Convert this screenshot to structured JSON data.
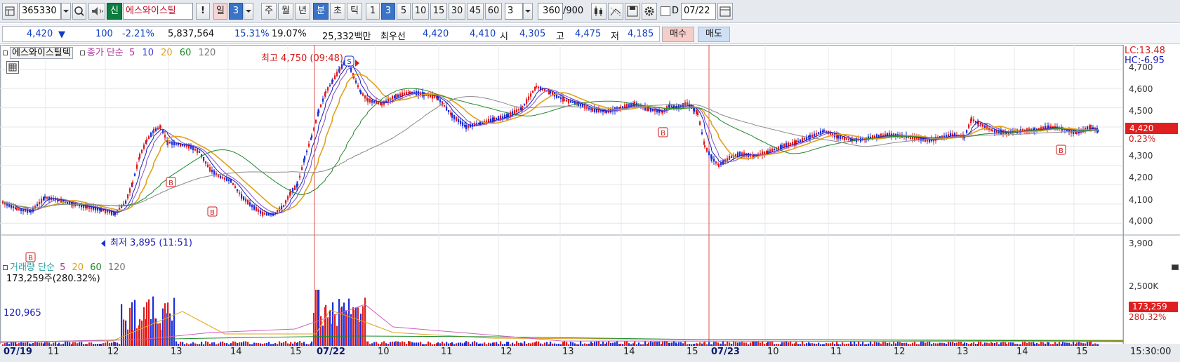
{
  "toolbar": {
    "code": "365330",
    "new_label": "신",
    "stock_name": "에스와이스틸",
    "alert_label": "!",
    "period_day": "일",
    "period_day_num": "3",
    "period_week": "주",
    "period_month": "월",
    "period_year": "년",
    "period_min": "분",
    "period_sec": "초",
    "period_tick": "틱",
    "minute_options": [
      "1",
      "3",
      "5",
      "10",
      "15",
      "30",
      "45",
      "60"
    ],
    "selected_minute": "3",
    "interval_value": "3",
    "count_value": "360",
    "count_max": "/900",
    "d_label": "D",
    "date_value": "07/22",
    "colors": {
      "selected": "#3b73c6",
      "new_badge": "#0c7d3f",
      "name_text": "#c0102b"
    }
  },
  "quote": {
    "price": "4,420",
    "change_icon": "down-triangle-icon",
    "change": "100",
    "change_pct": "-2.21%",
    "volume": "5,837,564",
    "volume_pct": "15.31%",
    "turnover_pct": "19.07%",
    "amount": "25,332백만",
    "best_label": "최우선",
    "best_ask": "4,420",
    "best_bid": "4,410",
    "open_label": "시",
    "open": "4,305",
    "high_label": "고",
    "high": "4,475",
    "low_label": "저",
    "low": "4,185",
    "buy_label": "매수",
    "sell_label": "매도"
  },
  "legend": {
    "stock_name": "에스와이스틸텍",
    "ma_title": "종가 단순",
    "periods": [
      "5",
      "10",
      "20",
      "60",
      "120"
    ],
    "volume_title": "거래량 단순",
    "vol_periods": [
      "5",
      "20",
      "60",
      "120"
    ],
    "volume_stat": "173,259주(280.32%)",
    "vol_left_value": "120,965"
  },
  "annotations": {
    "high_text": "최고 4,750 (09:48)",
    "low_text": "최저 3,895 (11:51)",
    "lc_text": "LC:13.48",
    "hc_text": "HC:-6.95",
    "current_price_tag": "4,420",
    "current_pct": "0.23%",
    "vol_tag": "173,259",
    "vol_pct": "280.32%",
    "signal_b": "B",
    "signal_s": "S"
  },
  "chart_data": {
    "type": "candlestick",
    "interval": "3분",
    "price_axis_ticks": [
      "4,700",
      "4,600",
      "4,500",
      "4,400",
      "4,300",
      "4,200",
      "4,100",
      "4,000",
      "3,900"
    ],
    "price_range": [
      3850,
      4790
    ],
    "volume_axis_ticks": [
      "2,500K"
    ],
    "x_labels": [
      "07/19",
      "11",
      "12",
      "13",
      "14",
      "15",
      "07/22",
      "10",
      "11",
      "12",
      "13",
      "14",
      "15",
      "07/23",
      "10",
      "11",
      "12",
      "13",
      "14",
      "15"
    ],
    "time_label": "15:30:00",
    "price_path": [
      [
        0,
        4010
      ],
      [
        20,
        3975
      ],
      [
        40,
        3960
      ],
      [
        60,
        4035
      ],
      [
        80,
        4020
      ],
      [
        100,
        4000
      ],
      [
        120,
        3985
      ],
      [
        140,
        3970
      ],
      [
        160,
        3950
      ],
      [
        175,
        4010
      ],
      [
        185,
        4110
      ],
      [
        195,
        4250
      ],
      [
        205,
        4330
      ],
      [
        215,
        4380
      ],
      [
        225,
        4400
      ],
      [
        235,
        4320
      ],
      [
        250,
        4310
      ],
      [
        265,
        4300
      ],
      [
        280,
        4270
      ],
      [
        295,
        4180
      ],
      [
        310,
        4140
      ],
      [
        325,
        4120
      ],
      [
        340,
        4040
      ],
      [
        355,
        3990
      ],
      [
        370,
        3950
      ],
      [
        385,
        3945
      ],
      [
        400,
        3990
      ],
      [
        410,
        4060
      ],
      [
        420,
        4100
      ],
      [
        430,
        4240
      ],
      [
        440,
        4350
      ],
      [
        450,
        4480
      ],
      [
        460,
        4580
      ],
      [
        470,
        4640
      ],
      [
        480,
        4700
      ],
      [
        490,
        4750
      ],
      [
        500,
        4660
      ],
      [
        510,
        4580
      ],
      [
        520,
        4540
      ],
      [
        540,
        4520
      ],
      [
        560,
        4560
      ],
      [
        580,
        4580
      ],
      [
        600,
        4570
      ],
      [
        620,
        4550
      ],
      [
        640,
        4460
      ],
      [
        660,
        4400
      ],
      [
        680,
        4420
      ],
      [
        700,
        4440
      ],
      [
        720,
        4460
      ],
      [
        740,
        4500
      ],
      [
        760,
        4610
      ],
      [
        780,
        4580
      ],
      [
        800,
        4540
      ],
      [
        820,
        4520
      ],
      [
        840,
        4490
      ],
      [
        860,
        4480
      ],
      [
        880,
        4500
      ],
      [
        900,
        4520
      ],
      [
        920,
        4490
      ],
      [
        940,
        4480
      ],
      [
        950,
        4510
      ],
      [
        960,
        4500
      ],
      [
        975,
        4520
      ],
      [
        985,
        4490
      ],
      [
        990,
        4470
      ],
      [
        1000,
        4300
      ],
      [
        1010,
        4240
      ],
      [
        1020,
        4200
      ],
      [
        1035,
        4240
      ],
      [
        1050,
        4260
      ],
      [
        1070,
        4250
      ],
      [
        1090,
        4270
      ],
      [
        1110,
        4300
      ],
      [
        1130,
        4320
      ],
      [
        1150,
        4350
      ],
      [
        1170,
        4380
      ],
      [
        1190,
        4350
      ],
      [
        1210,
        4330
      ],
      [
        1230,
        4340
      ],
      [
        1260,
        4360
      ],
      [
        1290,
        4350
      ],
      [
        1320,
        4330
      ],
      [
        1350,
        4360
      ],
      [
        1370,
        4350
      ],
      [
        1380,
        4440
      ],
      [
        1390,
        4420
      ],
      [
        1410,
        4380
      ],
      [
        1430,
        4370
      ],
      [
        1450,
        4380
      ],
      [
        1470,
        4385
      ],
      [
        1490,
        4400
      ],
      [
        1510,
        4390
      ],
      [
        1530,
        4370
      ],
      [
        1550,
        4400
      ],
      [
        1560,
        4380
      ]
    ],
    "ma_series": [
      {
        "name": "5",
        "color": "#1a1ab8",
        "smooth": 2
      },
      {
        "name": "10",
        "color": "#7a52c9",
        "smooth": 4
      },
      {
        "name": "20",
        "color": "#e0a21a",
        "smooth": 8
      },
      {
        "name": "60",
        "color": "#1f8a2a",
        "smooth": 22
      },
      {
        "name": "120",
        "color": "#8a8a8a",
        "smooth": 40
      }
    ]
  }
}
